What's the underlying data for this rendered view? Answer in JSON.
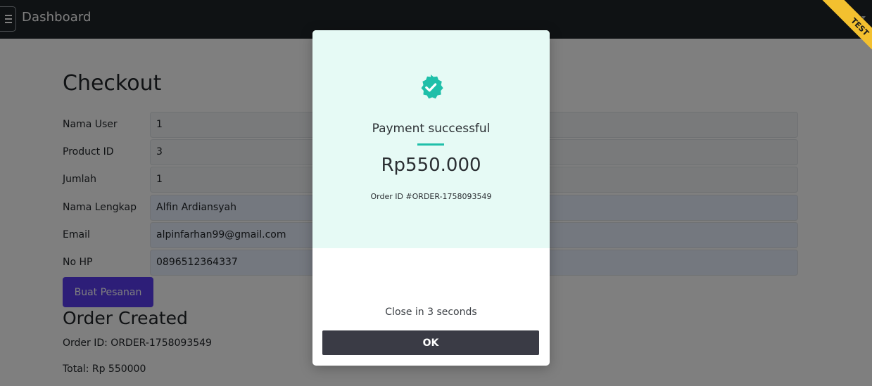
{
  "navbar": {
    "menu_icon": "hamburger-icon",
    "title": "Dashboard",
    "account_icon": "user-circle-icon",
    "bg_color": "#1f2428"
  },
  "checkout": {
    "title": "Checkout",
    "fields": [
      {
        "label": "Nama User",
        "value": "1"
      },
      {
        "label": "Product ID",
        "value": "3"
      },
      {
        "label": "Jumlah",
        "value": "1"
      },
      {
        "label": "Nama Lengkap",
        "value": "Alfin Ardiansyah"
      },
      {
        "label": "Email",
        "value": "alpinfarhan99@gmail.com"
      },
      {
        "label": "No HP",
        "value": "0896512364337"
      }
    ],
    "submit_label": "Buat Pesanan",
    "submit_color": "#5a3cf0"
  },
  "order": {
    "heading": "Order Created",
    "order_id_line": "Order ID: ORDER-1758093549",
    "total_line": "Total: Rp 550000"
  },
  "modal": {
    "icon": "check-badge-icon",
    "title": "Payment successful",
    "amount": "Rp550.000",
    "order_id": "Order ID #ORDER-1758093549",
    "countdown": "Close in 3 seconds",
    "ok_label": "OK",
    "accent_color": "#1fbfa9",
    "top_bg": "#e6faf5"
  },
  "ribbon": {
    "label": "TEST",
    "color": "#f3c02f"
  }
}
